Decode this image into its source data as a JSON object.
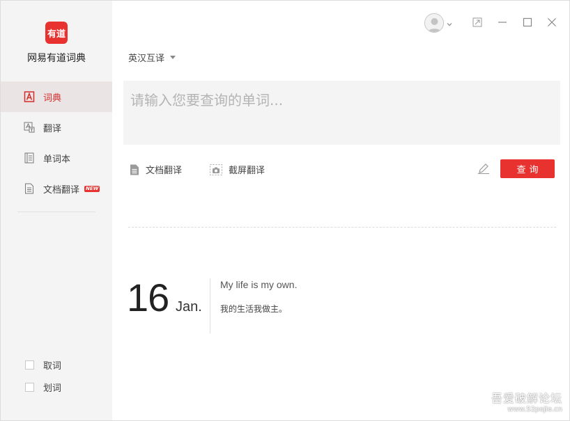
{
  "app": {
    "logo_text": "有道",
    "name": "网易有道词典"
  },
  "sidebar": {
    "items": [
      {
        "label": "词典",
        "icon": "dictionary-icon",
        "active": true
      },
      {
        "label": "翻译",
        "icon": "translate-icon",
        "active": false
      },
      {
        "label": "单词本",
        "icon": "wordbook-icon",
        "active": false
      },
      {
        "label": "文档翻译",
        "icon": "document-icon",
        "active": false,
        "badge": "NEW"
      }
    ],
    "options": [
      {
        "label": "取词",
        "checked": false
      },
      {
        "label": "划词",
        "checked": false
      }
    ]
  },
  "titlebar": {
    "icons": [
      "avatar-icon",
      "chevron-down-icon",
      "pin-icon",
      "minimize-icon",
      "maximize-icon",
      "close-icon"
    ]
  },
  "main": {
    "language": "英汉互译",
    "search_placeholder": "请输入您要查询的单词...",
    "doc_translate": "文档翻译",
    "screenshot_translate": "截屏翻译",
    "query_button": "查询"
  },
  "daily": {
    "day": "16",
    "month": "Jan.",
    "quote_en": "My life is my own.",
    "quote_cn": "我的生活我做主。"
  },
  "watermark": {
    "line1": "吾爱破解论坛",
    "line2": "www.52pojie.cn"
  },
  "colors": {
    "accent": "#e8322f",
    "sidebar_bg": "#f4f4f4",
    "active_item_bg": "#ebe4e4"
  }
}
